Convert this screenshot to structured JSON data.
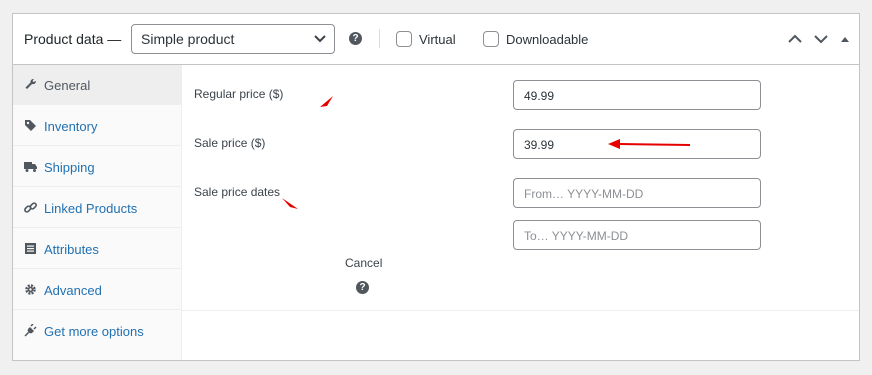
{
  "header": {
    "title": "Product data —",
    "product_type": "Simple product",
    "help_icon": "question-mark-icon",
    "virtual_label": "Virtual",
    "downloadable_label": "Downloadable",
    "controls": [
      "chevron-up-icon",
      "chevron-down-icon",
      "collapse-triangle-icon"
    ]
  },
  "sidebar": {
    "items": [
      {
        "label": "General",
        "icon": "wrench-icon"
      },
      {
        "label": "Inventory",
        "icon": "tag-icon"
      },
      {
        "label": "Shipping",
        "icon": "truck-icon"
      },
      {
        "label": "Linked Products",
        "icon": "link-icon"
      },
      {
        "label": "Attributes",
        "icon": "list-icon"
      },
      {
        "label": "Advanced",
        "icon": "gear-icon"
      },
      {
        "label": "Get more options",
        "icon": "plug-icon"
      }
    ],
    "active_index": 0
  },
  "fields": {
    "regular_price_label": "Regular price ($)",
    "regular_price_value": "49.99",
    "sale_price_label": "Sale price ($)",
    "sale_price_value": "39.99",
    "sale_dates_label": "Sale price dates",
    "from_placeholder": "From… YYYY-MM-DD",
    "to_placeholder": "To…  YYYY-MM-DD",
    "cancel_label": "Cancel"
  },
  "colors": {
    "annotation_arrow": "#e50000",
    "link": "#2271b1"
  }
}
